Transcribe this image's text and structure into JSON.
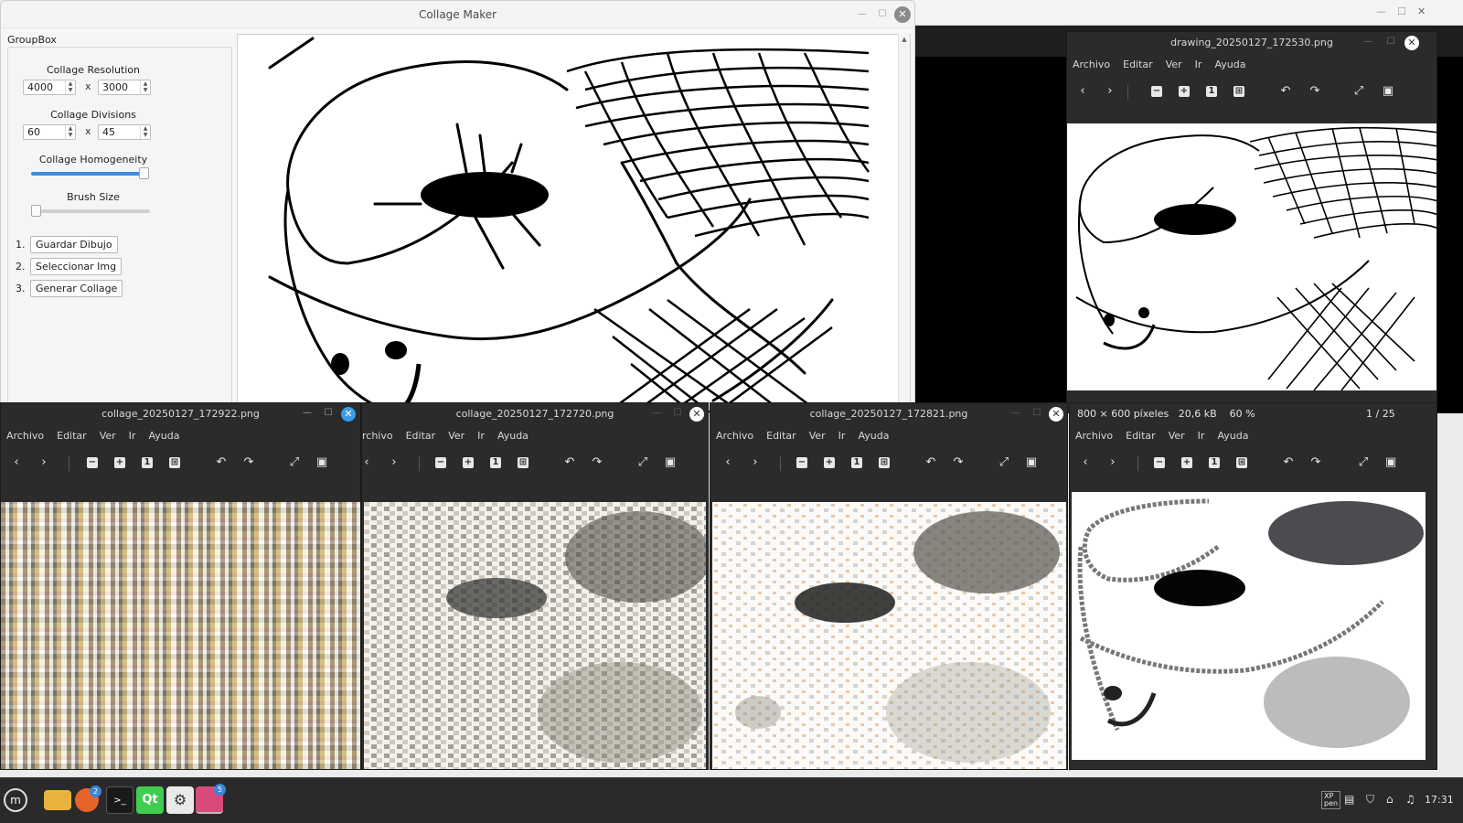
{
  "collage_maker": {
    "title": "Collage Maker",
    "groupbox_label": "GroupBox",
    "resolution": {
      "label": "Collage Resolution",
      "width": "4000",
      "height": "3000",
      "sep": "x"
    },
    "divisions": {
      "label": "Collage Divisions",
      "cols": "60",
      "rows": "45",
      "sep": "x"
    },
    "homogeneity": {
      "label": "Collage Homogeneity",
      "value_fraction": 1.0
    },
    "brush": {
      "label": "Brush Size",
      "value_fraction": 0.0
    },
    "steps": [
      {
        "num": "1.",
        "label": "Guardar Dibujo"
      },
      {
        "num": "2.",
        "label": "Seleccionar Img"
      },
      {
        "num": "3.",
        "label": "Generar Collage"
      }
    ]
  },
  "viewer_menu": [
    "Archivo",
    "Editar",
    "Ver",
    "Ir",
    "Ayuda"
  ],
  "viewers": {
    "drawing": {
      "title": "drawing_20250127_172530.png"
    },
    "collage1": {
      "title": "collage_20250127_172922.png"
    },
    "collage2": {
      "title": "collage_20250127_172720.png",
      "menu_first": "rchivo"
    },
    "collage3": {
      "title": "collage_20250127_172821.png"
    },
    "collage4": {
      "status_size": "800 × 600 píxeles",
      "status_kb": "20,6 kB",
      "status_zoom": "60 %",
      "status_page": "1 / 25"
    }
  },
  "taskbar": {
    "icons": [
      "mint-menu-icon",
      "files-icon",
      "firefox-icon",
      "terminal-icon",
      "qt-creator-icon",
      "settings-icon",
      "image-viewer-icon"
    ],
    "firefox_badge": "2",
    "viewer_badge": "5",
    "qt_label": "Qt",
    "clock": "17:31"
  },
  "colors": {
    "accent": "#3d8ede",
    "viewer_bg": "#2b2b2b",
    "taskbar_bg": "#2a2a2a"
  }
}
